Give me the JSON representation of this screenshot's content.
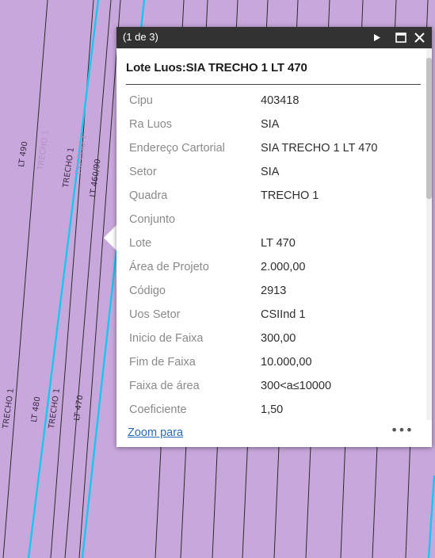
{
  "map": {
    "background_color": "#c8a8dc",
    "line_color": "#2a2a2a",
    "accent_line_color": "#19c7f0",
    "labels": [
      {
        "text": "LT 490",
        "faded": false
      },
      {
        "text": "TRECHO 1",
        "faded": true
      },
      {
        "text": "TRECHO 1",
        "faded": false
      },
      {
        "text": "TRECHO 1",
        "faded": true
      },
      {
        "text": "LT 460/90",
        "faded": false
      },
      {
        "text": "TRECHO 1",
        "faded": false
      },
      {
        "text": "LT 480",
        "faded": false
      },
      {
        "text": "TRECHO 1",
        "faded": false
      },
      {
        "text": "LT 470",
        "faded": false
      }
    ]
  },
  "popup": {
    "count_label": "(1 de 3)",
    "next_icon": "play-triangle",
    "maximize_icon": "square-outline",
    "close_icon": "x-mark",
    "title": "Lote Luos:SIA TRECHO 1 LT 470",
    "attributes": [
      {
        "name": "Cipu",
        "value": "403418"
      },
      {
        "name": "Ra Luos",
        "value": "SIA"
      },
      {
        "name": "Endereço Cartorial",
        "value": "SIA TRECHO 1 LT 470"
      },
      {
        "name": "Setor",
        "value": "SIA"
      },
      {
        "name": "Quadra",
        "value": "TRECHO 1"
      },
      {
        "name": "Conjunto",
        "value": ""
      },
      {
        "name": "Lote",
        "value": "LT 470"
      },
      {
        "name": "Área de Projeto",
        "value": "2.000,00"
      },
      {
        "name": "Código",
        "value": "2913"
      },
      {
        "name": "Uos Setor",
        "value": "CSIInd 1"
      },
      {
        "name": "Inicio de Faixa",
        "value": "300,00"
      },
      {
        "name": "Fim de Faixa",
        "value": "10.000,00"
      },
      {
        "name": "Faixa de área",
        "value": "300<a≤10000"
      },
      {
        "name": "Coeficiente",
        "value": "1,50"
      }
    ],
    "zoom_link": "Zoom para",
    "more_icon": "ellipsis"
  }
}
